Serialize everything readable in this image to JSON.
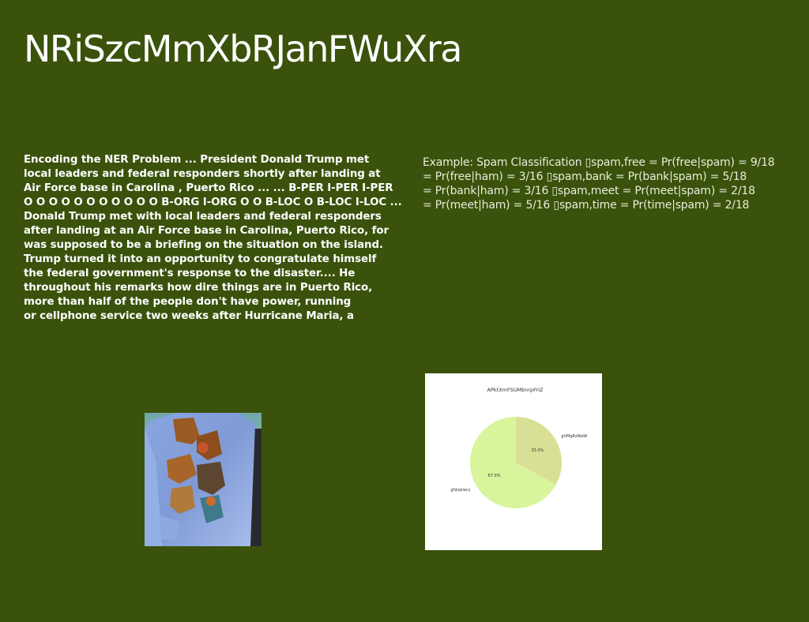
{
  "page": {
    "title": "NRiSzcMmXbRJanFWuXra",
    "background_color": "#3a520b"
  },
  "left_text": {
    "lines": [
      "Encoding the NER Problem ... President Donald Trump met",
      "local leaders and federal responders shortly after landing at",
      "Air Force base in Carolina , Puerto Rico ... ... B-PER I-PER I-PER",
      "O O O O O O O O O O O B-ORG I-ORG O O B-LOC O B-LOC I-LOC ...",
      "Donald Trump met with local leaders and federal responders",
      "after landing at an Air Force base in Carolina, Puerto Rico, for",
      "was supposed to be a briefing on the situation on the island.",
      "Trump turned it into an opportunity to congratulate himself",
      "the federal government's response to the disaster.... He",
      "throughout his remarks how dire things are in Puerto Rico,",
      "more than half of the people don't have power, running",
      "or cellphone service two weeks after Hurricane Maria, a"
    ]
  },
  "right_text": {
    "lines": [
      "Example: Spam Classification ▯spam,free = Pr(free|spam) = 9/18",
      "= Pr(free|ham) = 3/16 ▯spam,bank = Pr(bank|spam) = 5/18",
      "= Pr(bank|ham) = 3/16 ▯spam,meet = Pr(meet|spam) = 2/18",
      "= Pr(meet|ham) = 5/16 ▯spam,time = Pr(time|spam) = 2/18"
    ]
  },
  "photo": {
    "description_icon": "shirt-photo"
  },
  "chart_data": {
    "type": "pie",
    "title": "APktXmFSUMbnrpFrIZ",
    "labels": [
      "gVMgRzWaW",
      "ghjiqslacy"
    ],
    "values": [
      33.0,
      67.0
    ],
    "value_labels": [
      "33.0%",
      "67.0%"
    ],
    "colors": [
      "#d9e096",
      "#d8f59b"
    ]
  }
}
